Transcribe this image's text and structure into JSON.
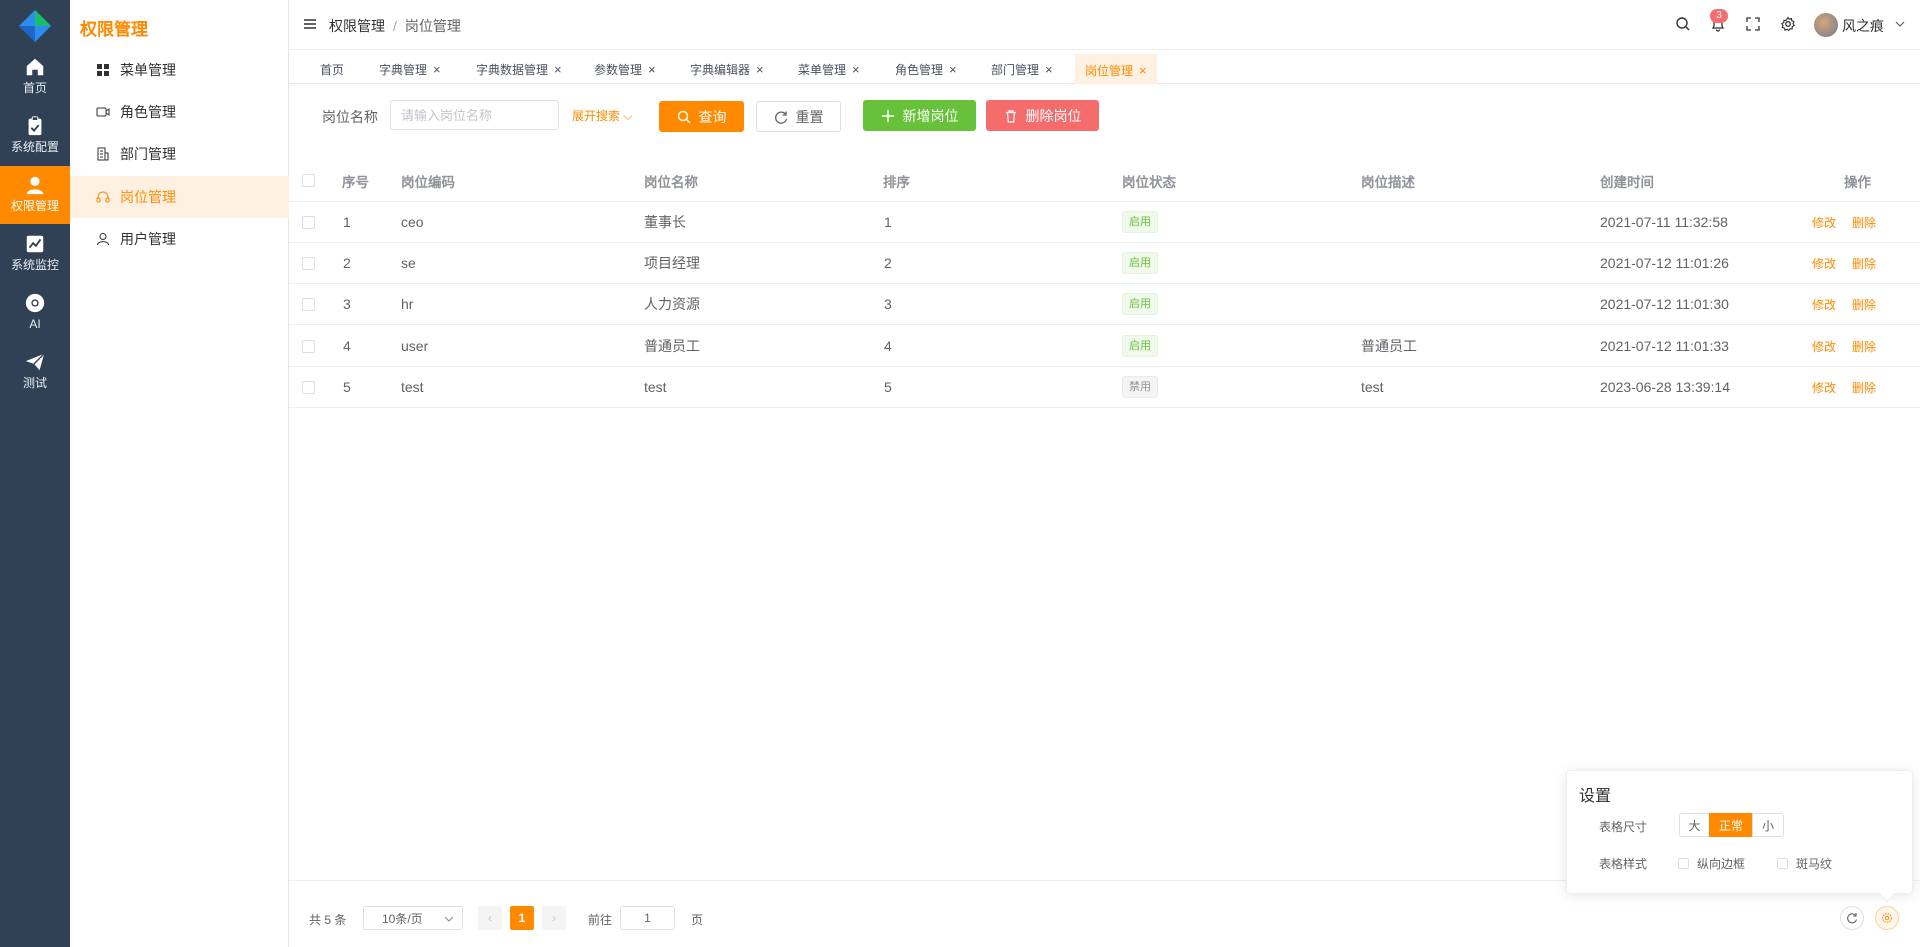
{
  "rail": {
    "items": [
      {
        "label": "首页",
        "icon": "home-icon"
      },
      {
        "label": "系统配置",
        "icon": "clipboard-icon"
      },
      {
        "label": "权限管理",
        "icon": "user-icon"
      },
      {
        "label": "系统监控",
        "icon": "chart-icon"
      },
      {
        "label": "AI",
        "icon": "chrome-icon"
      },
      {
        "label": "测试",
        "icon": "send-icon"
      }
    ],
    "active_index": 2,
    "bg_color": "#304156",
    "active_color": "#ff8a00"
  },
  "submenu": {
    "title": "权限管理",
    "items": [
      {
        "label": "菜单管理",
        "icon": "grid-icon"
      },
      {
        "label": "角色管理",
        "icon": "video-icon"
      },
      {
        "label": "部门管理",
        "icon": "building-icon"
      },
      {
        "label": "岗位管理",
        "icon": "headset-icon"
      },
      {
        "label": "用户管理",
        "icon": "person-icon"
      }
    ],
    "active_index": 3
  },
  "header": {
    "breadcrumb": [
      "权限管理",
      "岗位管理"
    ],
    "separator": "/",
    "notification_count": "3",
    "username": "风之痕"
  },
  "tabs": [
    {
      "label": "首页",
      "closable": false
    },
    {
      "label": "字典管理",
      "closable": true
    },
    {
      "label": "字典数据管理",
      "closable": true
    },
    {
      "label": "参数管理",
      "closable": true
    },
    {
      "label": "字典编辑器",
      "closable": true
    },
    {
      "label": "菜单管理",
      "closable": true
    },
    {
      "label": "角色管理",
      "closable": true
    },
    {
      "label": "部门管理",
      "closable": true
    },
    {
      "label": "岗位管理",
      "closable": true,
      "active": true
    }
  ],
  "search": {
    "label": "岗位名称",
    "placeholder": "请输入岗位名称",
    "expand_label": "展开搜索",
    "query_label": "查询",
    "reset_label": "重置",
    "add_label": "新增岗位",
    "delete_label": "删除岗位"
  },
  "table": {
    "columns": [
      "序号",
      "岗位编码",
      "岗位名称",
      "排序",
      "岗位状态",
      "岗位描述",
      "创建时间",
      "操作"
    ],
    "rows": [
      {
        "no": "1",
        "code": "ceo",
        "name": "董事长",
        "sort": "1",
        "status": "启用",
        "status_on": true,
        "desc": "",
        "created": "2021-07-11 11:32:58"
      },
      {
        "no": "2",
        "code": "se",
        "name": "项目经理",
        "sort": "2",
        "status": "启用",
        "status_on": true,
        "desc": "",
        "created": "2021-07-12 11:01:26"
      },
      {
        "no": "3",
        "code": "hr",
        "name": "人力资源",
        "sort": "3",
        "status": "启用",
        "status_on": true,
        "desc": "",
        "created": "2021-07-12 11:01:30"
      },
      {
        "no": "4",
        "code": "user",
        "name": "普通员工",
        "sort": "4",
        "status": "启用",
        "status_on": true,
        "desc": "普通员工",
        "created": "2021-07-12 11:01:33"
      },
      {
        "no": "5",
        "code": "test",
        "name": "test",
        "sort": "5",
        "status": "禁用",
        "status_on": false,
        "desc": "test",
        "created": "2023-06-28 13:39:14"
      }
    ],
    "edit_label": "修改",
    "delete_label": "删除"
  },
  "pagination": {
    "total_text": "共 5 条",
    "page_size": "10条/页",
    "current_page": "1",
    "goto_label": "前往",
    "goto_value": "1",
    "page_unit": "页"
  },
  "settings": {
    "title": "设置",
    "size_label": "表格尺寸",
    "sizes": [
      "大",
      "正常",
      "小"
    ],
    "active_size_index": 1,
    "style_label": "表格样式",
    "style_options": [
      "纵向边框",
      "斑马纹"
    ]
  },
  "colors": {
    "primary": "#ff8a00",
    "success": "#67c23a",
    "danger": "#f56c6c"
  }
}
